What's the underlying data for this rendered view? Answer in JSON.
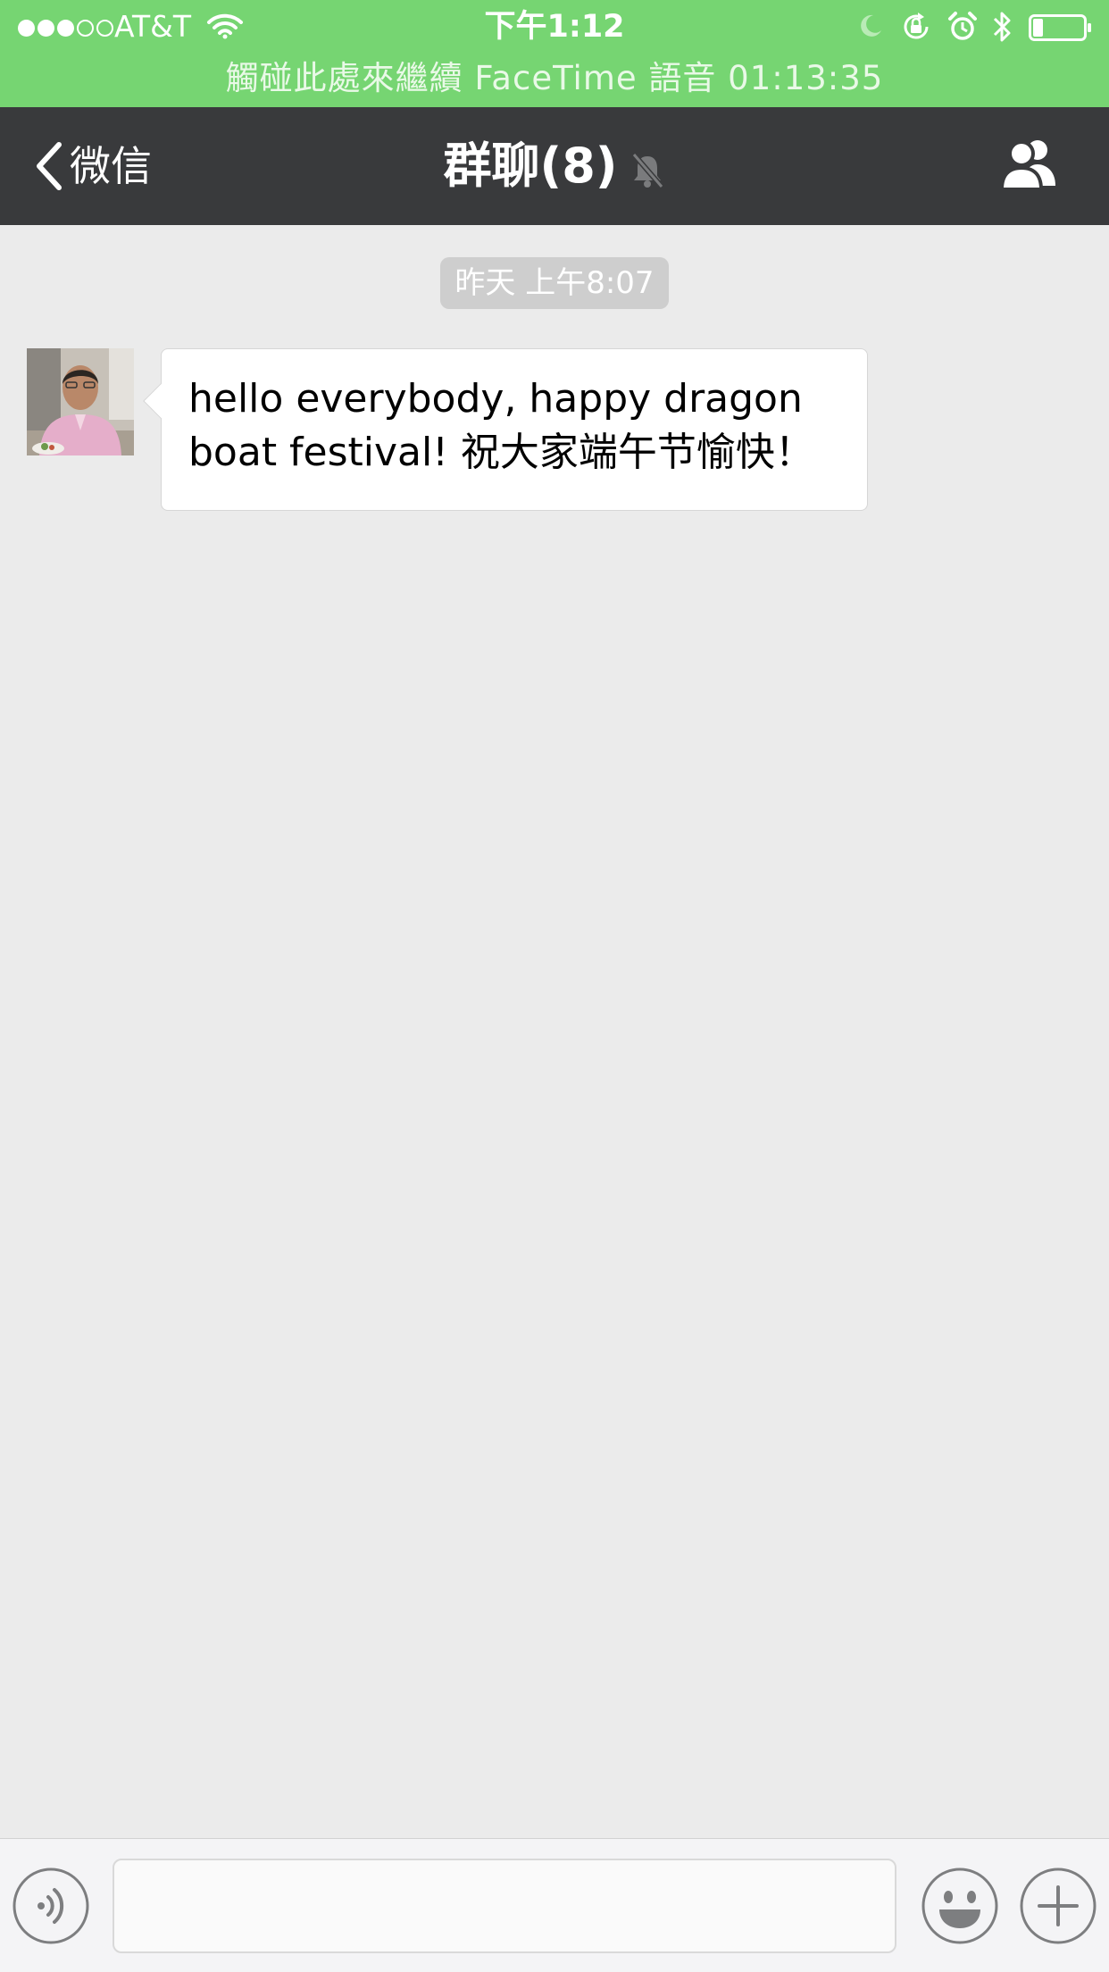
{
  "status_bar": {
    "signal_filled": 3,
    "signal_total": 5,
    "carrier": "AT&T",
    "time": "下午1:12",
    "facetime_banner": "觸碰此處來繼續 FaceTime 語音 01:13:35",
    "battery_level": 0.2
  },
  "navbar": {
    "back_label": "微信",
    "title": "群聊(8)"
  },
  "chat": {
    "timestamp": "昨天 上午8:07",
    "messages": [
      {
        "text": "hello everybody, happy dragon boat festival! 祝大家端午节愉快！"
      }
    ]
  },
  "toolbar": {
    "input_value": ""
  },
  "colors": {
    "status_green": "#76d572",
    "navbar_bg": "#393a3c",
    "chat_bg": "#ebebeb",
    "bubble_bg": "#ffffff",
    "timestamp_bg": "#cecece"
  },
  "icons": [
    "wifi-icon",
    "moon-icon",
    "rotation-lock-icon",
    "alarm-icon",
    "bluetooth-icon",
    "battery-icon",
    "back-chevron-icon",
    "mute-bell-icon",
    "group-members-icon",
    "voice-icon",
    "emoji-icon",
    "plus-icon"
  ]
}
